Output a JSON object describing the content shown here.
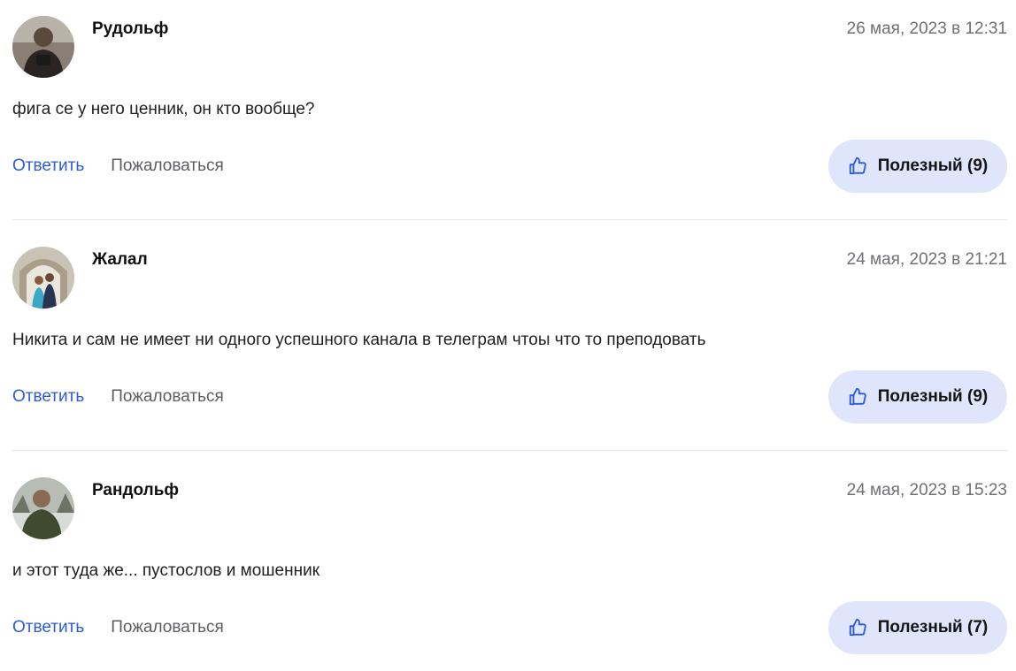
{
  "reviews": [
    {
      "author": "Рудольф",
      "date": "26 мая, 2023 в 12:31",
      "text": "фига се у него ценник, он кто вообще?",
      "reply_label": "Ответить",
      "report_label": "Пожаловаться",
      "useful_label": "Полезный (9)",
      "avatar_icon": "avatar-photo"
    },
    {
      "author": "Жалал",
      "date": "24 мая, 2023 в 21:21",
      "text": "Никита и сам не имеет ни одного успешного канала в телеграм чтоы что то преподовать",
      "reply_label": "Ответить",
      "report_label": "Пожаловаться",
      "useful_label": "Полезный (9)",
      "avatar_icon": "avatar-photo"
    },
    {
      "author": "Рандольф",
      "date": "24 мая, 2023 в 15:23",
      "text": "и этот туда же... пустослов и мошенник",
      "reply_label": "Ответить",
      "report_label": "Пожаловаться",
      "useful_label": "Полезный (7)",
      "avatar_icon": "avatar-photo"
    }
  ],
  "colors": {
    "link": "#2c5ad8",
    "muted": "#5c5d62",
    "date": "#6f7075",
    "useful_bg": "#dfe5fb",
    "divider": "#e6e8ee"
  },
  "icons": {
    "useful": "thumbs-up-icon"
  }
}
